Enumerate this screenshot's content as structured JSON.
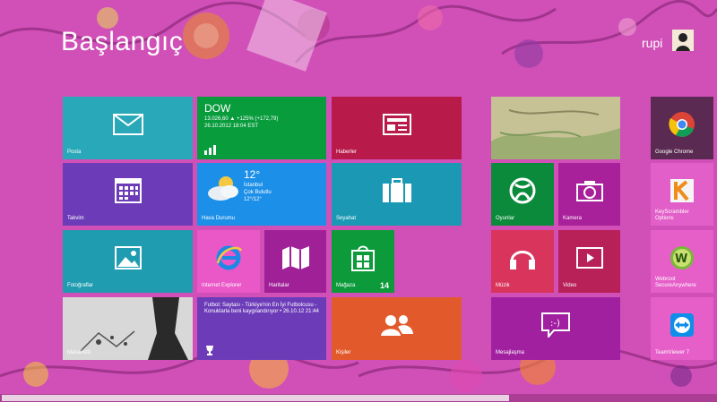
{
  "start": {
    "title": "Başlangıç"
  },
  "user": {
    "name": "rupi"
  },
  "tiles": {
    "mail": {
      "label": "Posta",
      "color": "#28a8b8"
    },
    "finance": {
      "heading": "DOW",
      "line1": "13.026,60 ▲ +125% (+172,79)",
      "line2": "26.10.2012 18:04 EST",
      "color": "#089c3c"
    },
    "news": {
      "label": "Haberler",
      "color": "#b81a4a"
    },
    "photo": {
      "color": "#b8b480"
    },
    "chrome": {
      "label": "Google Chrome",
      "color": "#5a2a52"
    },
    "calendar": {
      "label": "Takvim",
      "color": "#6c3cb8"
    },
    "weather": {
      "temp": "12°",
      "city": "İstanbul",
      "condition": "Çok Bulutlu",
      "range": "12°/12°",
      "label": "Hava Durumu",
      "color": "#1c8fe8"
    },
    "travel": {
      "label": "Seyahat",
      "color": "#1a98b4"
    },
    "games": {
      "label": "Oyunlar",
      "color": "#0a8a3a"
    },
    "camera": {
      "label": "Kamera",
      "color": "#a8209a"
    },
    "keescrambler": {
      "label": "KeyScrambler Options",
      "color": "#e25ec8"
    },
    "photos": {
      "label": "Fotoğraflar",
      "color": "#1f9cb0"
    },
    "ie": {
      "label": "Internet Explorer",
      "color": "#ea58c8"
    },
    "maps": {
      "label": "Haritalar",
      "color": "#a02098"
    },
    "store": {
      "label": "Mağaza",
      "badge": "14",
      "color": "#0c9a3a"
    },
    "music": {
      "label": "Müzik",
      "color": "#d8345c"
    },
    "video": {
      "label": "Video",
      "color": "#b82058"
    },
    "webroot": {
      "label": "Webroot SecureAnywhere",
      "color": "#e65ec8"
    },
    "desktop": {
      "label": "Masaüstü",
      "color": "#cfcfcf"
    },
    "sports": {
      "text": "Futbol: Saytası - Türkiye'nin En İyi Futbolcusu - Konuklarla beni kaygılandırıyor • 26.10.12 21:44",
      "color": "#6c3cb8"
    },
    "people": {
      "label": "Kişiler",
      "color": "#e25a2c"
    },
    "messaging": {
      "label": "Mesajlaşma",
      "color": "#a020a0"
    },
    "teamviewer": {
      "label": "TeamViewer 7",
      "color": "#e65ec8"
    }
  }
}
